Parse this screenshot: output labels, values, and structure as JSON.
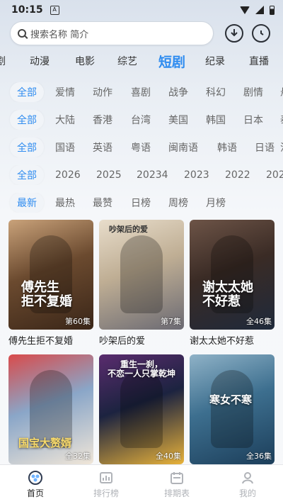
{
  "status": {
    "time": "10:15"
  },
  "search": {
    "placeholder": "搜索名称 简介"
  },
  "top_tabs": [
    "剧",
    "动漫",
    "电影",
    "综艺",
    "短剧",
    "纪录",
    "直播"
  ],
  "top_tab_active_index": 4,
  "filters": {
    "genre": [
      "全部",
      "爱情",
      "动作",
      "喜剧",
      "战争",
      "科幻",
      "剧情",
      "悬"
    ],
    "region": [
      "全部",
      "大陆",
      "香港",
      "台湾",
      "美国",
      "韩国",
      "日本",
      "泰"
    ],
    "language": [
      "全部",
      "国语",
      "英语",
      "粤语",
      "闽南语",
      "韩语",
      "日语",
      "法"
    ],
    "year": [
      "全部",
      "2026",
      "2025",
      "20234",
      "2023",
      "2022",
      "202"
    ],
    "sort": [
      "最新",
      "最热",
      "最赞",
      "日榜",
      "周榜",
      "月榜"
    ]
  },
  "items": [
    {
      "title": "傅先生拒不复婚",
      "episodes": "第60集",
      "overlay": "傅先生\n拒不复婚",
      "colors": [
        "#6b4a2f",
        "#c9a27a",
        "#3a2618"
      ]
    },
    {
      "title": "吵架后的爱",
      "episodes": "第7集",
      "overlay": "吵架后的爱",
      "colors": [
        "#bfae94",
        "#e8ddcb",
        "#6b6a73"
      ]
    },
    {
      "title": "谢太太她不好惹",
      "episodes": "全46集",
      "overlay": "谢太太她\n不好惹",
      "colors": [
        "#3a2b25",
        "#6d5447",
        "#1f2a3b"
      ]
    },
    {
      "title": "",
      "episodes": "全32集",
      "overlay": "国宝大赘婿",
      "colors": [
        "#8aa6c8",
        "#d94b4b",
        "#f0e6d8"
      ]
    },
    {
      "title": "",
      "episodes": "全40集",
      "overlay": "重生一刹，\n不恋一人只掌乾坤",
      "colors": [
        "#1c2340",
        "#5a2c6e",
        "#e8b23a"
      ]
    },
    {
      "title": "",
      "episodes": "全36集",
      "overlay": "寒女不寒",
      "colors": [
        "#3d6f8f",
        "#8fb2c7",
        "#1c3e5a"
      ]
    }
  ],
  "bottom_nav": [
    {
      "label": "首页",
      "icon": "home-icon",
      "active": true
    },
    {
      "label": "排行榜",
      "icon": "ranking-icon",
      "active": false
    },
    {
      "label": "排期表",
      "icon": "calendar-icon",
      "active": false
    },
    {
      "label": "我的",
      "icon": "profile-icon",
      "active": false
    }
  ],
  "colors": {
    "accent": "#2f8cf0",
    "inactive_nav": "#b0b3b8"
  }
}
